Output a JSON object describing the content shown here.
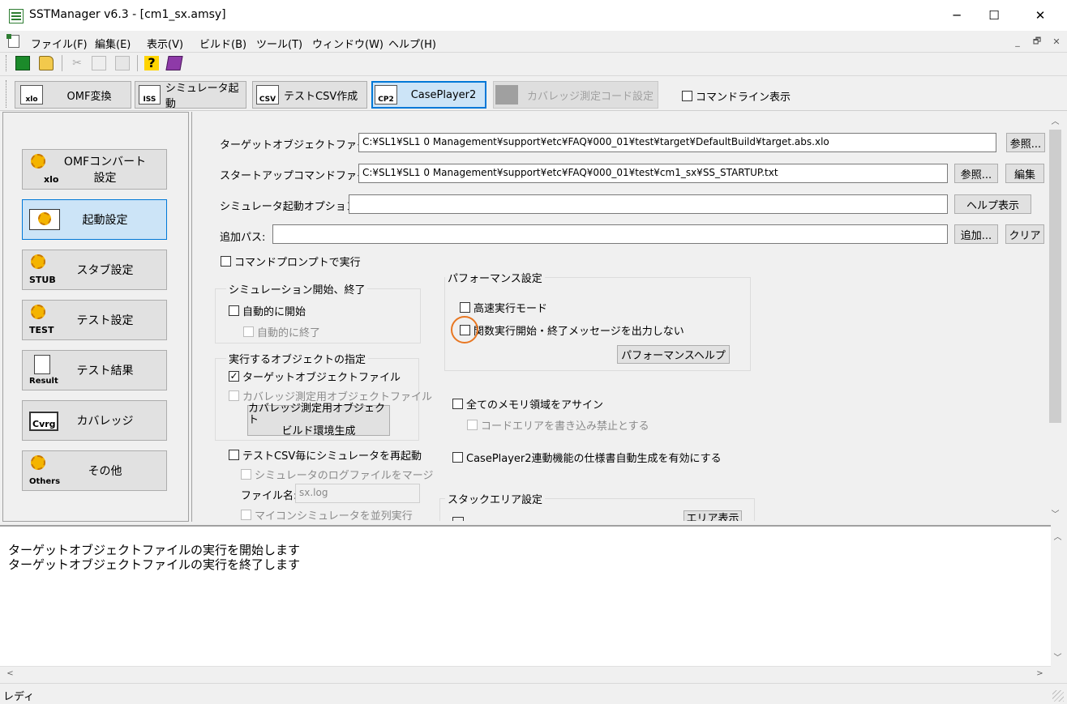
{
  "window": {
    "title": "SSTManager v6.3 - [cm1_sx.amsy]",
    "minimize": "─",
    "maximize": "☐",
    "close": "✕"
  },
  "menu": [
    "ファイル(F)",
    "編集(E)",
    "表示(V)",
    "ビルド(B)",
    "ツール(T)",
    "ウィンドウ(W)",
    "ヘルプ(H)"
  ],
  "mdi_controls": [
    "_",
    "🗗",
    "✕"
  ],
  "toolbar2": {
    "omf": "OMF変換",
    "sim_start": "シミュレータ起動",
    "test_csv": "テストCSV作成",
    "caseplayer": "CasePlayer2",
    "coverage_code": "カバレッジ測定コード設定",
    "cmdline": "コマンドライン表示"
  },
  "nav": [
    {
      "label": "OMFコンバート設定",
      "tag": "xlo"
    },
    {
      "label": "起動設定",
      "tag": ""
    },
    {
      "label": "スタブ設定",
      "tag": "STUB"
    },
    {
      "label": "テスト設定",
      "tag": "TEST"
    },
    {
      "label": "テスト結果",
      "tag": "Result"
    },
    {
      "label": "カバレッジ",
      "tag": "Cvrg"
    },
    {
      "label": "その他",
      "tag": "Others"
    }
  ],
  "form": {
    "target_label": "ターゲットオブジェクトファイル:",
    "target_value": "C:¥SL1¥SL1 0 Management¥support¥etc¥FAQ¥000_01¥test¥target¥DefaultBuild¥target.abs.xlo",
    "browse": "参照...",
    "startup_label": "スタートアップコマンドファイル:",
    "startup_value": "C:¥SL1¥SL1 0 Management¥support¥etc¥FAQ¥000_01¥test¥cm1_sx¥SS_STARTUP.txt",
    "edit": "編集",
    "simopt_label": "シミュレータ起動オプション:",
    "simopt_value": "",
    "help_show": "ヘルプ表示",
    "path_label": "追加パス:",
    "path_value": "",
    "add": "追加...",
    "clear": "クリア",
    "cmd_prompt": "コマンドプロンプトで実行"
  },
  "sim_group": {
    "title": "シミュレーション開始、終了",
    "auto_start": "自動的に開始",
    "auto_end": "自動的に終了"
  },
  "obj_group": {
    "title": "実行するオブジェクトの指定",
    "target_obj": "ターゲットオブジェクトファイル",
    "coverage_obj": "カバレッジ測定用オブジェクトファイル",
    "build_btn_line1": "カバレッジ測定用オブジェクト",
    "build_btn_line2": "ビルド環境生成"
  },
  "csv_restart": "テストCSV毎にシミュレータを再起動",
  "merge_log": "シミュレータのログファイルをマージ",
  "file_name_label": "ファイル名:",
  "file_name_value": "sx.log",
  "parallel": "マイコンシミュレータを並列実行",
  "perf_group": {
    "title": "パフォーマンス設定",
    "fast_mode": "高速実行モード",
    "no_func_msg": "関数実行開始・終了メッセージを出力しない",
    "perf_help": "パフォーマンスヘルプ"
  },
  "assign_all_mem": "全てのメモリ領域をアサイン",
  "code_area_protect": "コードエリアを書き込み禁止とする",
  "caseplayer_spec": "CasePlayer2連動機能の仕様書自動生成を有効にする",
  "stack_group": {
    "title": "スタックエリア設定",
    "area_show": "エリア表示"
  },
  "output": {
    "line1": "ターゲットオブジェクトファイルの実行を開始します",
    "line2": "ターゲットオブジェクトファイルの実行を終了します"
  },
  "status": "レディ",
  "colors": {
    "highlight_circle": "#e87722",
    "active_nav": "#cce4f7",
    "active_border": "#0078d7"
  }
}
